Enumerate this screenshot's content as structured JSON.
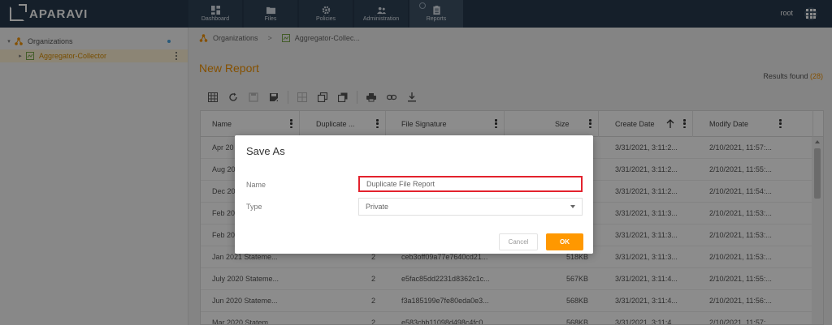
{
  "app": {
    "logo_text": "APARAVI",
    "user": "root"
  },
  "nav": [
    {
      "label": "Dashboard",
      "icon": "dashboard-icon"
    },
    {
      "label": "Files",
      "icon": "folder-icon"
    },
    {
      "label": "Policies",
      "icon": "gear-icon"
    },
    {
      "label": "Administration",
      "icon": "users-icon"
    },
    {
      "label": "Reports",
      "icon": "report-icon"
    }
  ],
  "sidebar": {
    "items": [
      {
        "label": "Organizations"
      },
      {
        "label": "Aggregator-Collector"
      }
    ]
  },
  "breadcrumb": {
    "org": "Organizations",
    "node": "Aggregator-Collec..."
  },
  "page": {
    "title": "New Report",
    "results_label": "Results found",
    "results_count": "(28)"
  },
  "table": {
    "columns": [
      "Name",
      "Duplicate ...",
      "File Signature",
      "Size",
      "Create Date",
      "Modify Date"
    ],
    "rows": [
      {
        "name": "Apr 20",
        "dup": "",
        "sig": "",
        "size": "",
        "created": "3/31/2021, 3:11:2...",
        "modified": "2/10/2021, 11:57:..."
      },
      {
        "name": "Aug 20",
        "dup": "",
        "sig": "",
        "size": "",
        "created": "3/31/2021, 3:11:2...",
        "modified": "2/10/2021, 11:55:..."
      },
      {
        "name": "Dec 20",
        "dup": "",
        "sig": "",
        "size": "",
        "created": "3/31/2021, 3:11:2...",
        "modified": "2/10/2021, 11:54:..."
      },
      {
        "name": "Feb 20",
        "dup": "",
        "sig": "",
        "size": "",
        "created": "3/31/2021, 3:11:3...",
        "modified": "2/10/2021, 11:53:..."
      },
      {
        "name": "Feb 20",
        "dup": "",
        "sig": "",
        "size": "",
        "created": "3/31/2021, 3:11:3...",
        "modified": "2/10/2021, 11:53:..."
      },
      {
        "name": "Jan 2021 Stateme...",
        "dup": "2",
        "sig": "ceb3off09a77e7640cd21...",
        "size": "518KB",
        "created": "3/31/2021, 3:11:3...",
        "modified": "2/10/2021, 11:53:..."
      },
      {
        "name": "July 2020 Stateme...",
        "dup": "2",
        "sig": "e5fac85dd2231d8362c1c...",
        "size": "567KB",
        "created": "3/31/2021, 3:11:4...",
        "modified": "2/10/2021, 11:55:..."
      },
      {
        "name": "Jun 2020 Stateme...",
        "dup": "2",
        "sig": "f3a185199e7fe80eda0e3...",
        "size": "568KB",
        "created": "3/31/2021, 3:11:4...",
        "modified": "2/10/2021, 11:56:..."
      },
      {
        "name": "Mar 2020 Statem...",
        "dup": "2",
        "sig": "e583cbb11098d498c4fc0...",
        "size": "568KB",
        "created": "3/31/2021, 3:11:4...",
        "modified": "2/10/2021, 11:57:..."
      }
    ]
  },
  "dialog": {
    "title": "Save As",
    "name_label": "Name",
    "name_value": "Duplicate File Report",
    "type_label": "Type",
    "type_value": "Private",
    "cancel_label": "Cancel",
    "ok_label": "OK"
  },
  "colors": {
    "accent": "#f29200",
    "topbar": "#273a4d",
    "highlight": "#e3222d"
  }
}
